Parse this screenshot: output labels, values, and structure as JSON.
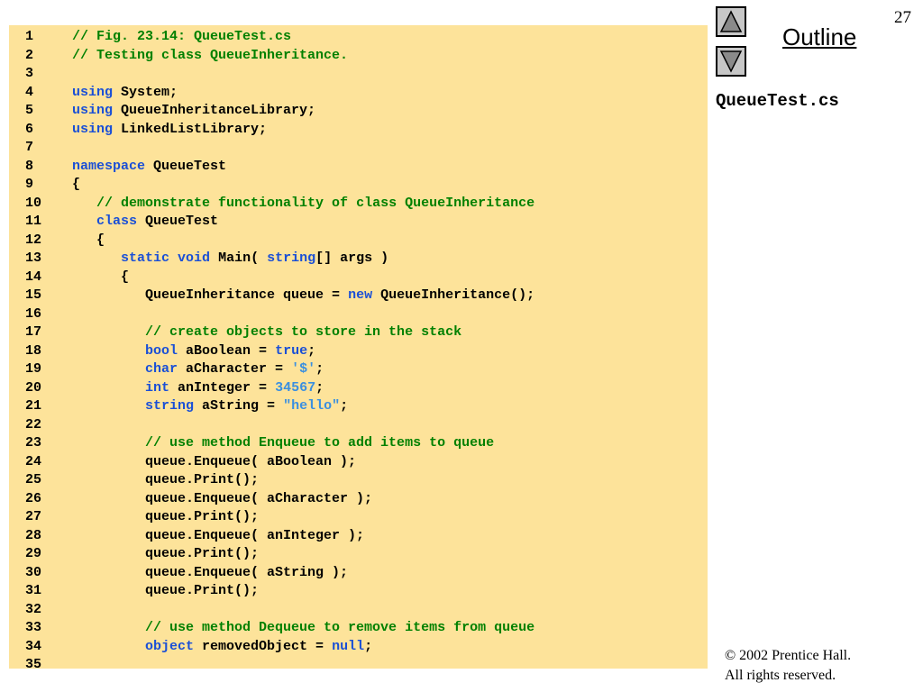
{
  "slide": {
    "page_number": "27",
    "outline_label": "Outline",
    "file_name": "QueueTest.cs",
    "copyright_line1": "© 2002 Prentice Hall.",
    "copyright_line2": "All rights reserved."
  },
  "nav": {
    "up_icon": "triangle-up-icon",
    "down_icon": "triangle-down-icon"
  },
  "colors": {
    "panel_bg": "#fde39a",
    "comment": "#008000",
    "keyword": "#1a4fd6",
    "literal": "#3a8fe0"
  },
  "code": [
    {
      "n": "1",
      "t": [
        [
          "// Fig. 23.14: QueueTest.cs",
          "comment"
        ]
      ]
    },
    {
      "n": "2",
      "t": [
        [
          "// Testing class QueueInheritance.",
          "comment"
        ]
      ]
    },
    {
      "n": "3",
      "t": []
    },
    {
      "n": "4",
      "t": [
        [
          "using",
          "keyword"
        ],
        [
          " System;",
          "plain"
        ]
      ]
    },
    {
      "n": "5",
      "t": [
        [
          "using",
          "keyword"
        ],
        [
          " QueueInheritanceLibrary;",
          "plain"
        ]
      ]
    },
    {
      "n": "6",
      "t": [
        [
          "using",
          "keyword"
        ],
        [
          " LinkedListLibrary;",
          "plain"
        ]
      ]
    },
    {
      "n": "7",
      "t": []
    },
    {
      "n": "8",
      "t": [
        [
          "namespace",
          "keyword"
        ],
        [
          " QueueTest",
          "plain"
        ]
      ]
    },
    {
      "n": "9",
      "t": [
        [
          "{",
          "plain"
        ]
      ]
    },
    {
      "n": "10",
      "t": [
        [
          "   ",
          "plain"
        ],
        [
          "// demonstrate functionality of class QueueInheritance",
          "comment"
        ]
      ]
    },
    {
      "n": "11",
      "t": [
        [
          "   ",
          "plain"
        ],
        [
          "class",
          "keyword"
        ],
        [
          " QueueTest",
          "plain"
        ]
      ]
    },
    {
      "n": "12",
      "t": [
        [
          "   {",
          "plain"
        ]
      ]
    },
    {
      "n": "13",
      "t": [
        [
          "      ",
          "plain"
        ],
        [
          "static",
          "keyword"
        ],
        [
          " ",
          "plain"
        ],
        [
          "void",
          "keyword"
        ],
        [
          " Main( ",
          "plain"
        ],
        [
          "string",
          "keyword"
        ],
        [
          "[] args )",
          "plain"
        ]
      ]
    },
    {
      "n": "14",
      "t": [
        [
          "      {",
          "plain"
        ]
      ]
    },
    {
      "n": "15",
      "t": [
        [
          "         QueueInheritance queue = ",
          "plain"
        ],
        [
          "new",
          "keyword"
        ],
        [
          " QueueInheritance();",
          "plain"
        ]
      ]
    },
    {
      "n": "16",
      "t": []
    },
    {
      "n": "17",
      "t": [
        [
          "         ",
          "plain"
        ],
        [
          "// create objects to store in the stack",
          "comment"
        ]
      ]
    },
    {
      "n": "18",
      "t": [
        [
          "         ",
          "plain"
        ],
        [
          "bool",
          "keyword"
        ],
        [
          " aBoolean = ",
          "plain"
        ],
        [
          "true",
          "keyword"
        ],
        [
          ";",
          "plain"
        ]
      ]
    },
    {
      "n": "19",
      "t": [
        [
          "         ",
          "plain"
        ],
        [
          "char",
          "keyword"
        ],
        [
          " aCharacter = ",
          "plain"
        ],
        [
          "'$'",
          "string"
        ],
        [
          ";",
          "plain"
        ]
      ]
    },
    {
      "n": "20",
      "t": [
        [
          "         ",
          "plain"
        ],
        [
          "int",
          "keyword"
        ],
        [
          " anInteger = ",
          "plain"
        ],
        [
          "34567",
          "number"
        ],
        [
          ";",
          "plain"
        ]
      ]
    },
    {
      "n": "21",
      "t": [
        [
          "         ",
          "plain"
        ],
        [
          "string",
          "keyword"
        ],
        [
          " aString = ",
          "plain"
        ],
        [
          "\"hello\"",
          "string"
        ],
        [
          ";",
          "plain"
        ]
      ]
    },
    {
      "n": "22",
      "t": []
    },
    {
      "n": "23",
      "t": [
        [
          "         ",
          "plain"
        ],
        [
          "// use method Enqueue to add items to queue",
          "comment"
        ]
      ]
    },
    {
      "n": "24",
      "t": [
        [
          "         queue.Enqueue( aBoolean );",
          "plain"
        ]
      ]
    },
    {
      "n": "25",
      "t": [
        [
          "         queue.Print();",
          "plain"
        ]
      ]
    },
    {
      "n": "26",
      "t": [
        [
          "         queue.Enqueue( aCharacter );",
          "plain"
        ]
      ]
    },
    {
      "n": "27",
      "t": [
        [
          "         queue.Print();",
          "plain"
        ]
      ]
    },
    {
      "n": "28",
      "t": [
        [
          "         queue.Enqueue( anInteger );",
          "plain"
        ]
      ]
    },
    {
      "n": "29",
      "t": [
        [
          "         queue.Print();",
          "plain"
        ]
      ]
    },
    {
      "n": "30",
      "t": [
        [
          "         queue.Enqueue( aString );",
          "plain"
        ]
      ]
    },
    {
      "n": "31",
      "t": [
        [
          "         queue.Print();",
          "plain"
        ]
      ]
    },
    {
      "n": "32",
      "t": []
    },
    {
      "n": "33",
      "t": [
        [
          "         ",
          "plain"
        ],
        [
          "// use method Dequeue to remove items from queue",
          "comment"
        ]
      ]
    },
    {
      "n": "34",
      "t": [
        [
          "         ",
          "plain"
        ],
        [
          "object",
          "keyword"
        ],
        [
          " removedObject = ",
          "plain"
        ],
        [
          "null",
          "keyword"
        ],
        [
          ";",
          "plain"
        ]
      ]
    },
    {
      "n": "35",
      "t": []
    }
  ]
}
